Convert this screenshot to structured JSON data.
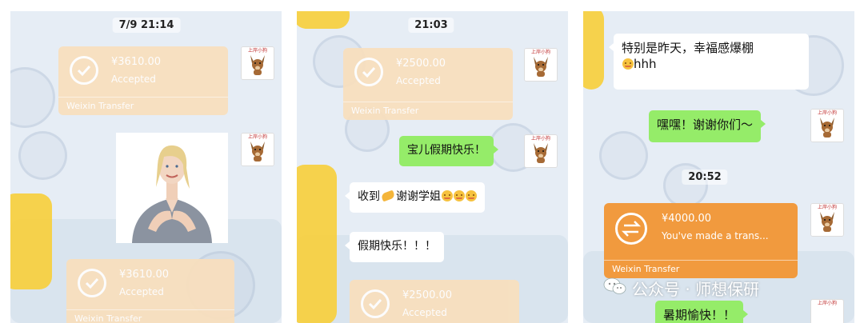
{
  "panel1": {
    "time": "7/9 21:14",
    "transfer_top": {
      "amount": "¥3610.00",
      "status": "Accepted",
      "footer": "Weixin Transfer"
    },
    "transfer_bottom": {
      "amount": "¥3610.00",
      "status": "Accepted",
      "footer": "Weixin Transfer"
    }
  },
  "panel2": {
    "time": "21:03",
    "transfer_top": {
      "amount": "¥2500.00",
      "status": "Accepted",
      "footer": "Weixin Transfer"
    },
    "msg_holiday": "宝儿假期快乐！",
    "msg_thanks": "收到",
    "msg_thanks_tail": "谢谢学姐",
    "msg_happy": "假期快乐！！！",
    "transfer_bottom": {
      "amount": "¥2500.00",
      "status": "Accepted"
    }
  },
  "panel3": {
    "msg_line1": "特别是昨天，幸福感爆棚",
    "msg_line2": "hhh",
    "msg_hehe": "嘿嘿！谢谢你们～",
    "time": "20:52",
    "transfer": {
      "amount": "¥4000.00",
      "status": "You've made a trans...",
      "footer": "Weixin Transfer"
    },
    "msg_bottom": "暑期愉快！！"
  },
  "avatar": {
    "caption": "上岸小狗"
  },
  "watermark": {
    "text": "公众号 · 师想保研"
  },
  "colors": {
    "green_bubble": "#95ec69",
    "transfer_pending": "#f19a3e",
    "transfer_done": "#f9dfbd",
    "chat_bg": "#e6edf5"
  }
}
